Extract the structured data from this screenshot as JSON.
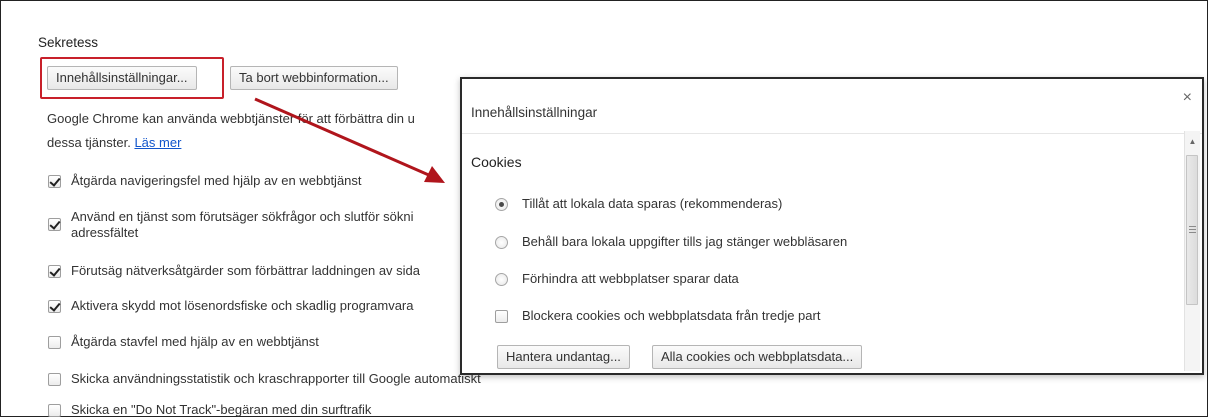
{
  "privacy": {
    "title": "Sekretess",
    "content_settings_button": "Innehållsinställningar...",
    "clear_browsing_button": "Ta bort webbinformation...",
    "description_line1": "Google Chrome kan använda webbtjänster för att förbättra din u",
    "description_line2": "dessa tjänster.",
    "learn_more": "Läs mer",
    "options": [
      {
        "label": "Åtgärda navigeringsfel med hjälp av en webbtjänst",
        "checked": true
      },
      {
        "label": "Använd en tjänst som förutsäger sökfrågor och slutför sökni",
        "label2": "adressfältet",
        "checked": true
      },
      {
        "label": "Förutsäg nätverksåtgärder som förbättrar laddningen av sida",
        "checked": true
      },
      {
        "label": "Aktivera skydd mot lösenordsfiske och skadlig programvara",
        "checked": true
      },
      {
        "label": "Åtgärda stavfel med hjälp av en webbtjänst",
        "checked": false
      },
      {
        "label": "Skicka användningsstatistik och kraschrapporter till Google automatiskt",
        "checked": false
      },
      {
        "label": "Skicka en \"Do Not Track\"-begäran med din surftrafik",
        "checked": false
      }
    ]
  },
  "dialog": {
    "title": "Innehållsinställningar",
    "close": "×",
    "section": "Cookies",
    "radio_options": [
      {
        "label": "Tillåt att lokala data sparas (rekommenderas)",
        "selected": true
      },
      {
        "label": "Behåll bara lokala uppgifter tills jag stänger webbläsaren",
        "selected": false
      },
      {
        "label": "Förhindra att webbplatser sparar data",
        "selected": false
      }
    ],
    "block_third_party": {
      "label": "Blockera cookies och webbplatsdata från tredje part",
      "checked": false
    },
    "manage_exceptions_button": "Hantera undantag...",
    "all_cookies_button": "Alla cookies och webbplatsdata..."
  },
  "colors": {
    "highlight": "#c8202a",
    "arrow": "#b0151c",
    "link": "#1155cc"
  }
}
